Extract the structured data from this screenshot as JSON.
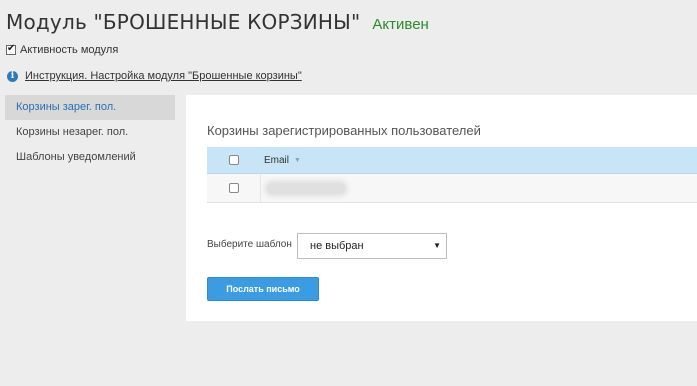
{
  "header": {
    "title": "Модуль \"БРОШЕННЫЕ КОРЗИНЫ\"",
    "status": "Активен"
  },
  "activity": {
    "label": "Активность модуля",
    "checked": true
  },
  "help": {
    "link_text": "Инструкция. Настройка модуля \"Брошенные корзины\""
  },
  "sidebar": {
    "items": [
      {
        "label": "Корзины зарег. пол.",
        "active": true
      },
      {
        "label": "Корзины незарег. пол.",
        "active": false
      },
      {
        "label": "Шаблоны уведомлений",
        "active": false
      }
    ]
  },
  "main": {
    "title": "Корзины зарегистрированных пользователей",
    "table": {
      "columns": [
        "Email"
      ],
      "rows": [
        {
          "email": ""
        }
      ]
    },
    "template": {
      "label": "Выберите шаблон",
      "selected": "не выбран"
    },
    "send_button": "Послать письмо"
  }
}
